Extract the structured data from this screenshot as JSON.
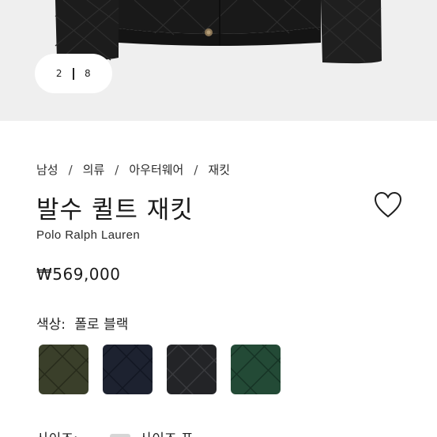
{
  "gallery": {
    "current": "2",
    "total": "8"
  },
  "breadcrumb": [
    "남성",
    "의류",
    "아우터웨어",
    "재킷"
  ],
  "breadcrumb_sep": "/",
  "product": {
    "title": "발수 퀼트 재킷",
    "brand": "Polo Ralph Lauren",
    "price": "₩569,000"
  },
  "color": {
    "label": "색상:",
    "selected": "폴로 블랙",
    "swatches": [
      {
        "name": "olive",
        "base": "#3a3f2a"
      },
      {
        "name": "navy",
        "base": "#1d2230"
      },
      {
        "name": "black",
        "base": "#232427"
      },
      {
        "name": "green",
        "base": "#234a36"
      }
    ]
  },
  "size": {
    "label": "사이즈:",
    "value": "사이즈 표"
  },
  "icons": {
    "wishlist": "heart-icon"
  }
}
